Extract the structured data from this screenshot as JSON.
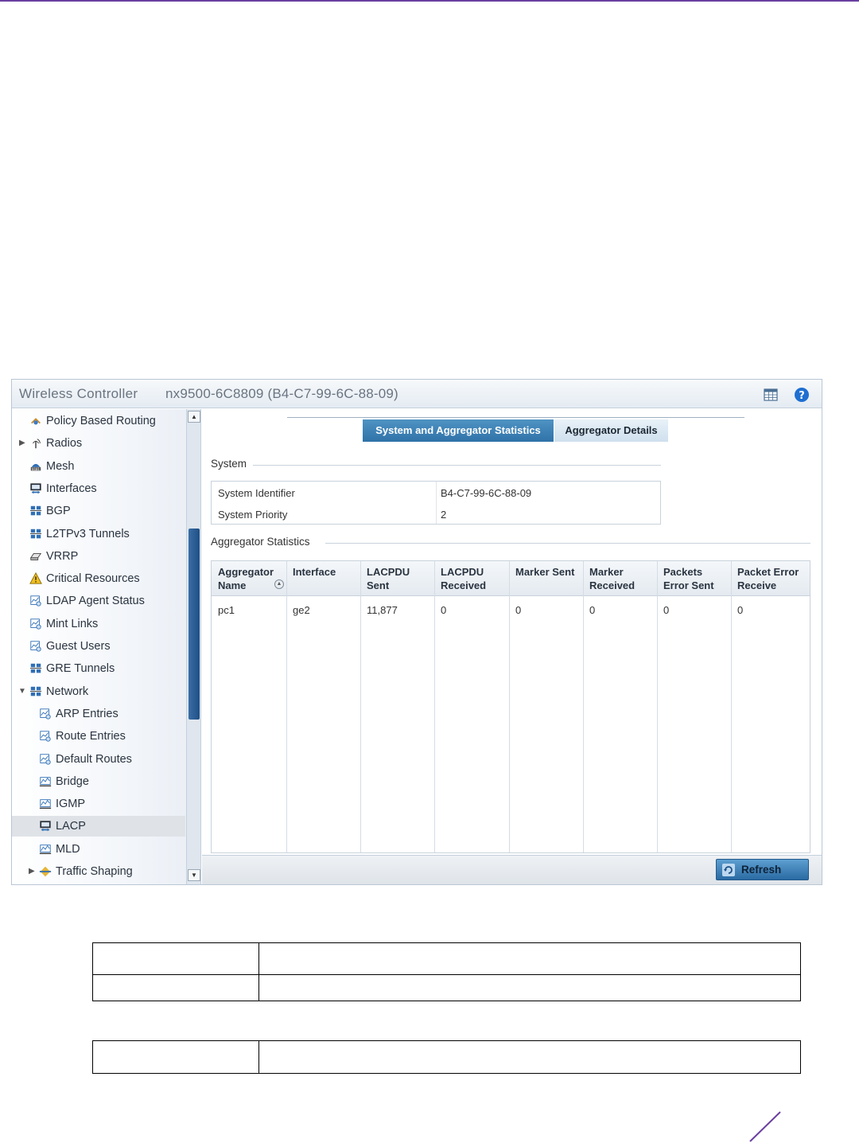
{
  "window": {
    "app_title": "Wireless Controller",
    "device_title": "nx9500-6C8809 (B4-C7-99-6C-88-09)",
    "grid_icon": "table-grid-icon",
    "help_icon": "help-question-icon"
  },
  "sidebar": {
    "items": [
      {
        "label": "Policy Based Routing",
        "icon": "routing-icon"
      },
      {
        "label": "Radios",
        "icon": "antenna-icon",
        "expandable": true
      },
      {
        "label": "Mesh",
        "icon": "mesh-icon"
      },
      {
        "label": "Interfaces",
        "icon": "monitor-interface-icon"
      },
      {
        "label": "BGP",
        "icon": "network-grid-icon"
      },
      {
        "label": "L2TPv3 Tunnels",
        "icon": "network-grid-icon"
      },
      {
        "label": "VRRP",
        "icon": "router-icon"
      },
      {
        "label": "Critical Resources",
        "icon": "warning-icon"
      },
      {
        "label": "LDAP Agent Status",
        "icon": "chart-icon"
      },
      {
        "label": "Mint Links",
        "icon": "chart-icon"
      },
      {
        "label": "Guest Users",
        "icon": "chart-icon"
      },
      {
        "label": "GRE Tunnels",
        "icon": "network-grid-icon"
      },
      {
        "label": "Network",
        "icon": "network-grid-icon",
        "expanded": true
      },
      {
        "label": "ARP Entries",
        "icon": "chart-icon",
        "child": true
      },
      {
        "label": "Route Entries",
        "icon": "chart-icon",
        "child": true
      },
      {
        "label": "Default Routes",
        "icon": "chart-icon",
        "child": true
      },
      {
        "label": "Bridge",
        "icon": "wave-chart-icon",
        "child": true
      },
      {
        "label": "IGMP",
        "icon": "wave-chart-icon",
        "child": true
      },
      {
        "label": "LACP",
        "icon": "monitor-interface-icon",
        "child": true,
        "selected": true
      },
      {
        "label": "MLD",
        "icon": "wave-chart-icon",
        "child": true
      },
      {
        "label": "Traffic Shaping",
        "icon": "shaping-icon",
        "child": true,
        "expandable": true
      }
    ]
  },
  "tabs": {
    "active": "System and Aggregator Statistics",
    "inactive": "Aggregator Details"
  },
  "system": {
    "section_label": "System",
    "identifier_label": "System Identifier",
    "identifier_value": "B4-C7-99-6C-88-09",
    "priority_label": "System Priority",
    "priority_value": "2"
  },
  "aggregator": {
    "section_label": "Aggregator Statistics",
    "headers": [
      [
        "Aggregator",
        "Name"
      ],
      [
        "Interface",
        ""
      ],
      [
        "LACPDU",
        "Sent"
      ],
      [
        "LACPDU",
        "Received"
      ],
      [
        "Marker Sent",
        ""
      ],
      [
        "Marker",
        "Received"
      ],
      [
        "Packets",
        "Error Sent"
      ],
      [
        "Packet Error",
        "Receive"
      ]
    ],
    "rows": [
      [
        "pc1",
        "ge2",
        "11,877",
        "0",
        "0",
        "0",
        "0",
        "0"
      ]
    ]
  },
  "footer": {
    "refresh_label": "Refresh"
  },
  "colors": {
    "accent": "#6b3fa0",
    "tab_active": "#2f72a8",
    "selected_row": "#dfe3e8"
  }
}
